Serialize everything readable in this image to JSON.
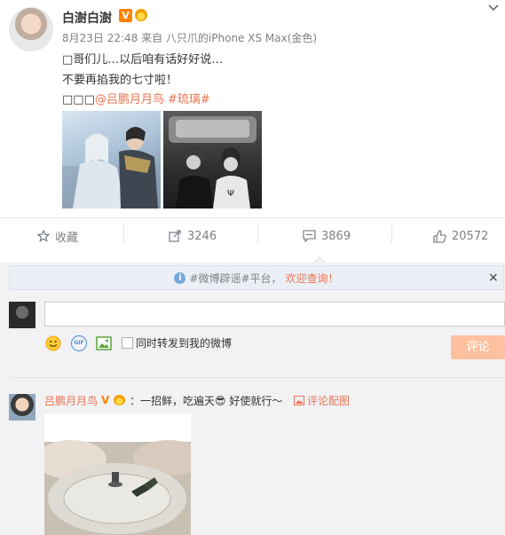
{
  "post": {
    "author": "白澍白澍",
    "vip_badge": "V",
    "meta": "8月23日 22:48 来自 八只爪的iPhone XS Max(金色)",
    "line1": "□哥们儿…以后咱有话好好说…",
    "line2": "不要再掐我的七寸啦！",
    "line3_prefix": "□□□",
    "mention": "@吕鹏月月鸟",
    "hashtag": "#琉璃#"
  },
  "actions": {
    "favorite_label": "收藏",
    "repost_count": "3246",
    "comment_count": "3869",
    "like_count": "20572"
  },
  "notice": {
    "prefix": "#微博辟谣#平台，",
    "highlight": "欢迎查询！",
    "close": "×"
  },
  "composer": {
    "repost_label": "同时转发到我的微博",
    "submit_label": "评论",
    "gif_label": "GIF"
  },
  "comment": {
    "author": "吕鹏月月鸟",
    "badge": "V",
    "text": "：一招鲜，吃遍天😎 好使就行～",
    "image_link": "评论配图"
  },
  "colors": {
    "accent": "#eb7350",
    "vip": "#ff8200",
    "submit_disabled": "#ffc09f",
    "notice_bg": "#eaf0f6",
    "panel_bg": "#f2f2f5"
  },
  "icons": {
    "favorite": "star-icon",
    "repost": "share-icon",
    "comment": "comment-icon",
    "like": "thumbs-up-icon",
    "info": "info-icon",
    "emoji": "smiley-icon",
    "gif": "gif-icon",
    "image": "image-icon",
    "comment_image": "picture-icon",
    "more": "chevron-down-icon"
  }
}
